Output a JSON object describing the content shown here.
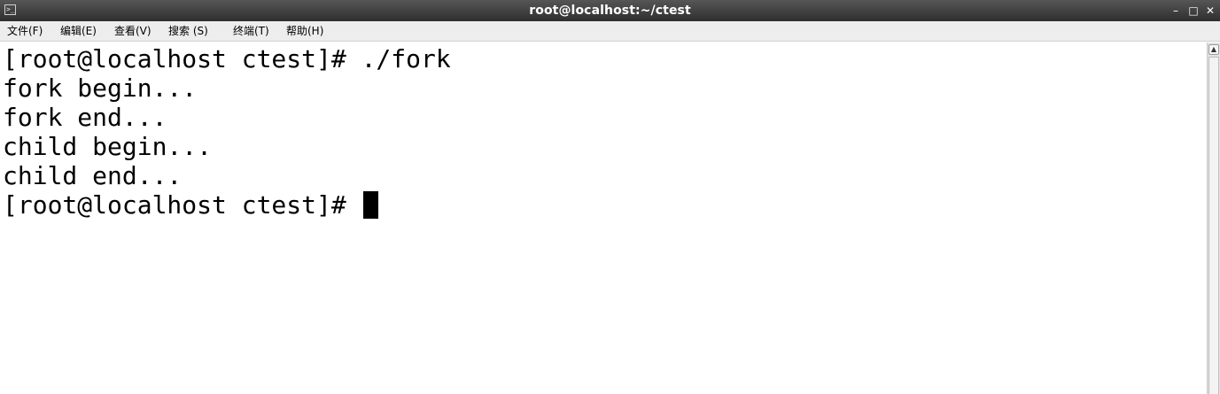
{
  "window": {
    "title": "root@localhost:~/ctest",
    "icon": "terminal-icon",
    "controls": {
      "minimize": "–",
      "maximize": "□",
      "close": "✕"
    }
  },
  "menu": [
    {
      "label": "文件(F)"
    },
    {
      "label": "编辑(E)"
    },
    {
      "label": "查看(V)"
    },
    {
      "label": "搜索 (S)"
    },
    {
      "label": "终端(T)"
    },
    {
      "label": "帮助(H)"
    }
  ],
  "terminal": {
    "lines": [
      "[root@localhost ctest]# ./fork",
      "fork begin...",
      "fork end...",
      "child begin...",
      "child end...",
      "[root@localhost ctest]# "
    ]
  },
  "scrollbar": {
    "up_arrow": "▲"
  },
  "colors": {
    "titlebar": "#3a3a3a",
    "menubar": "#ededed",
    "terminal_bg": "#ffffff",
    "terminal_fg": "#000000"
  }
}
